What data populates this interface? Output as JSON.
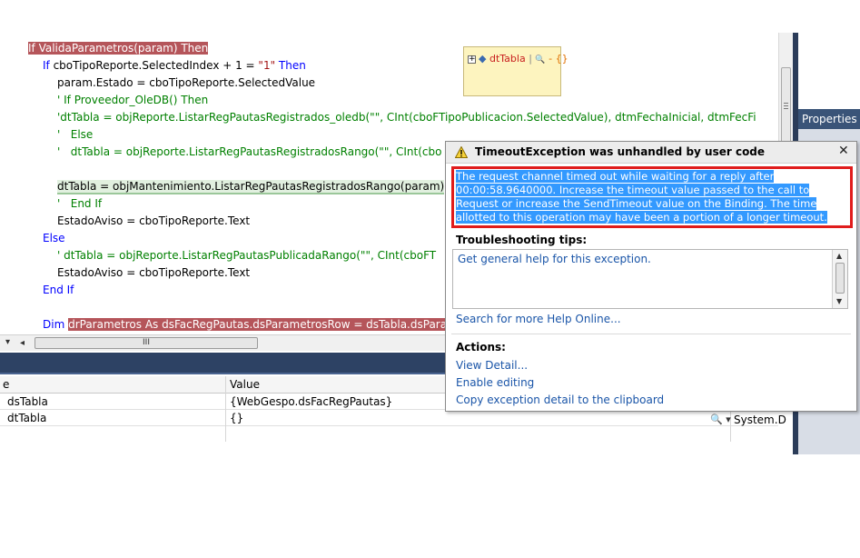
{
  "code": {
    "lines": [
      {
        "parts": [
          [
            "hl-red",
            "If ValidaParametros(param) Then"
          ]
        ]
      },
      {
        "parts": [
          [
            "kw",
            "If "
          ],
          [
            "",
            "cboTipoReporte.SelectedIndex + 1 = "
          ],
          [
            "str",
            "\"1\""
          ],
          [
            "kw",
            " Then"
          ]
        ]
      },
      {
        "parts": [
          [
            "",
            "param.Estado = cboTipoReporte.SelectedValue"
          ]
        ]
      },
      {
        "parts": [
          [
            "cm",
            "' If Proveedor_OleDB() Then"
          ]
        ]
      },
      {
        "parts": [
          [
            "cm",
            "'dtTabla = objReporte.ListarRegPautasRegistrados_oledb(\"\", CInt(cboFTipoPublicacion.SelectedValue), dtmFechaInicial, dtmFecFi"
          ]
        ]
      },
      {
        "parts": [
          [
            "cm",
            "'   Else"
          ]
        ]
      },
      {
        "parts": [
          [
            "cm",
            "'   dtTabla = objReporte.ListarRegPautasRegistradosRango(\"\", CInt(cbo"
          ]
        ]
      },
      {
        "parts": [
          [
            "",
            ""
          ]
        ]
      },
      {
        "parts": [
          [
            "hl-cur",
            "dtTabla = objMantenimiento.ListarRegPautasRegistradosRango(param)"
          ]
        ]
      },
      {
        "parts": [
          [
            "cm",
            "'   End If"
          ]
        ]
      },
      {
        "parts": [
          [
            "",
            "EstadoAviso = cboTipoReporte.Text"
          ]
        ]
      },
      {
        "parts": [
          [
            "kw",
            "Else"
          ]
        ]
      },
      {
        "parts": [
          [
            "cm",
            "' dtTabla = objReporte.ListarRegPautasPublicadaRango(\"\", CInt(cboFT"
          ]
        ]
      },
      {
        "parts": [
          [
            "",
            "EstadoAviso = cboTipoReporte.Text"
          ]
        ]
      },
      {
        "parts": [
          [
            "kw",
            "End If"
          ]
        ]
      },
      {
        "parts": [
          [
            "",
            ""
          ]
        ]
      },
      {
        "parts": [
          [
            "kw",
            "Dim "
          ],
          [
            "hl-red",
            "drParametros As dsFacRegPautas.dsParametrosRow = dsTabla.dsPara"
          ]
        ]
      }
    ]
  },
  "datatip": {
    "expand": "+",
    "name": "dtTabla",
    "search": "🔍",
    "value": "- {}"
  },
  "right_panel": {
    "properties_tab": "Properties"
  },
  "hscroll": {
    "grip": "III"
  },
  "grid": {
    "header": {
      "name": "e",
      "value": "Value"
    },
    "rows": [
      {
        "name": "dsTabla",
        "value": "{WebGespo.dsFacRegPautas}",
        "type": ""
      },
      {
        "name": "dtTabla",
        "value": "{}",
        "type": "System.D"
      }
    ]
  },
  "exception": {
    "title": "TimeoutException was unhandled by user code",
    "message": "The request channel timed out while waiting for a reply after 00:00:58.9640000. Increase the timeout value passed to the call to Request or increase the SendTimeout value on the Binding. The time allotted to this operation may have been a portion of a longer timeout.",
    "troubleshooting_title": "Troubleshooting tips:",
    "tips": [
      "Get general help for this exception."
    ],
    "search_link": "Search for more Help Online...",
    "actions_title": "Actions:",
    "actions": [
      "View Detail...",
      "Enable editing",
      "Copy exception detail to the clipboard"
    ],
    "close": "✕"
  },
  "colors": {
    "highlight_red": "#b5555a",
    "selection_blue": "#3399ff",
    "border_red": "#e01c1c",
    "link_blue": "#1a55a8",
    "dark_bar": "#2d4264"
  }
}
